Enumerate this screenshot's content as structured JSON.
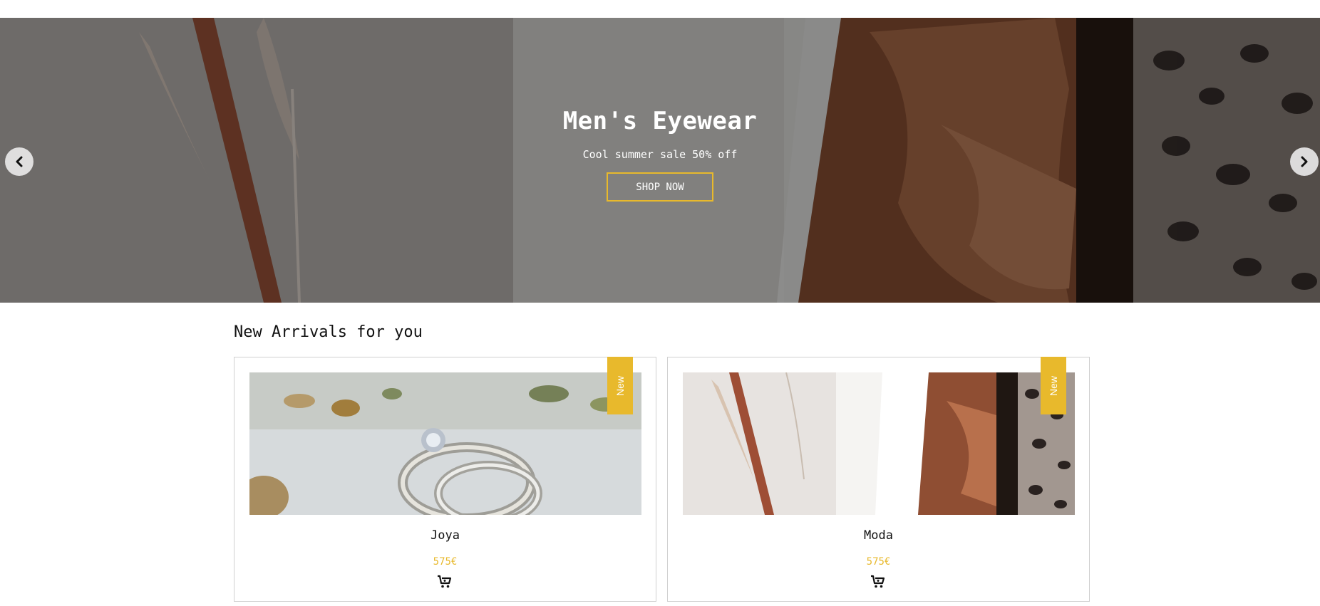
{
  "hero": {
    "title": "Men's Eyewear",
    "subtitle": "Cool summer sale 50% off",
    "button_label": "SHOP NOW",
    "prev_icon": "chevron-left-icon",
    "next_icon": "chevron-right-icon"
  },
  "section": {
    "title": "New Arrivals for you"
  },
  "products": [
    {
      "badge": "New",
      "name": "Joya",
      "price": "575€",
      "cart_icon": "cart-icon"
    },
    {
      "badge": "New",
      "name": "Moda",
      "price": "575€",
      "cart_icon": "cart-icon"
    }
  ],
  "colors": {
    "accent": "#e8b92c",
    "text": "#111111",
    "border": "#d0d0d0"
  }
}
